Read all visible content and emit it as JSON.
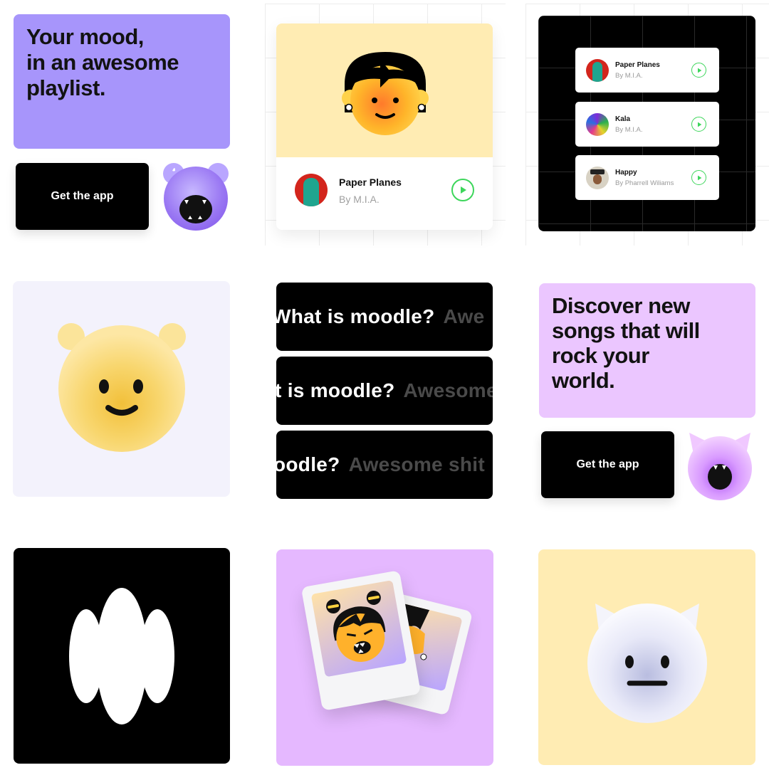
{
  "tile1": {
    "headline_line1": "Your mood,",
    "headline_line2": "in an awesome",
    "headline_line3": "playlist.",
    "cta_label": "Get the app",
    "bg_color": "#a795fb"
  },
  "tile2": {
    "track_title": "Paper Planes",
    "track_artist": "By M.I.A.",
    "bg_color": "#ffecb3"
  },
  "tile3": {
    "tracks": [
      {
        "title": "Paper Planes",
        "artist": "By M.I.A."
      },
      {
        "title": "Kala",
        "artist": "By M.I.A."
      },
      {
        "title": "Happy",
        "artist": "By Pharrell Wiliams"
      }
    ]
  },
  "tile5": {
    "row1": {
      "question": "What is moodle?",
      "answer": "Awe"
    },
    "row2": {
      "question": "t is moodle?",
      "answer": "Awesome"
    },
    "row3": {
      "question": "oodle?",
      "answer": "Awesome shit"
    }
  },
  "tile6": {
    "headline_line1": "Discover new",
    "headline_line2": "songs that will",
    "headline_line3": "rock your",
    "headline_line4": "world.",
    "cta_label": "Get the app",
    "bg_color": "#ebc6ff"
  },
  "colors": {
    "accent_green": "#3dd65b",
    "purple": "#a795fb",
    "pink": "#e5b8ff",
    "yellow": "#ffecb3",
    "black": "#000000"
  }
}
